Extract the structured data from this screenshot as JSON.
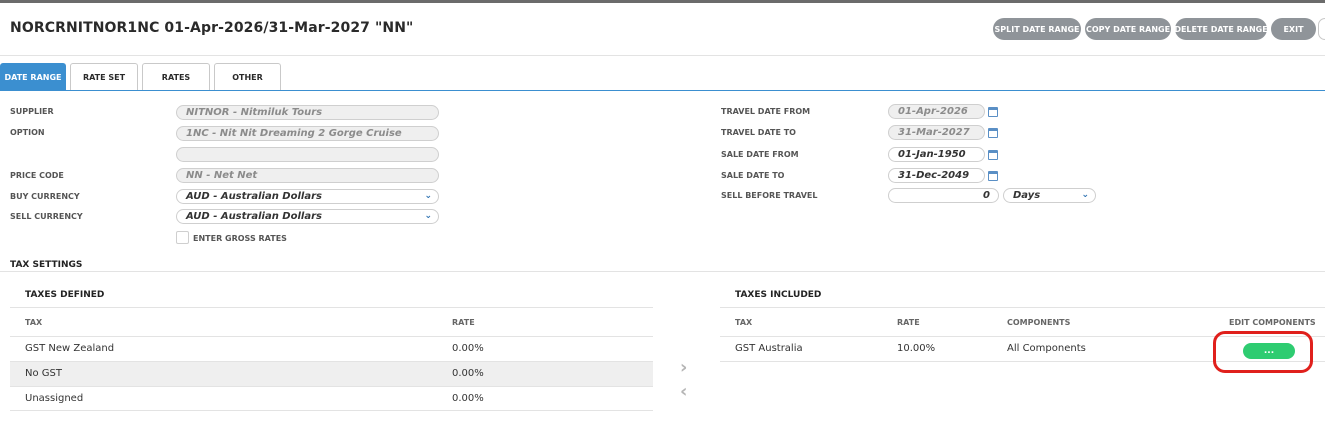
{
  "title": "NORCRNITNOR1NC 01-Apr-2026/31-Mar-2027 \"NN\"",
  "toolbar": {
    "split": "SPLIT DATE RANGE",
    "copy": "COPY DATE RANGE",
    "delete": "DELETE DATE RANGE",
    "exit": "EXIT"
  },
  "tabs": [
    "DATE RANGE",
    "RATE SET",
    "RATES",
    "OTHER"
  ],
  "form": {
    "supplier_label": "SUPPLIER",
    "supplier_value": "NITNOR - Nitmiluk Tours",
    "option_label": "OPTION",
    "option_value": "1NC - Nit Nit Dreaming 2 Gorge Cruise",
    "price_code_label": "PRICE CODE",
    "price_code_value": "NN - Net Net",
    "buy_currency_label": "BUY CURRENCY",
    "buy_currency_value": "AUD - Australian Dollars",
    "sell_currency_label": "SELL CURRENCY",
    "sell_currency_value": "AUD - Australian Dollars",
    "gross_rates_label": "ENTER GROSS RATES",
    "travel_from_label": "TRAVEL DATE FROM",
    "travel_from_value": "01-Apr-2026",
    "travel_to_label": "TRAVEL DATE TO",
    "travel_to_value": "31-Mar-2027",
    "sale_from_label": "SALE DATE FROM",
    "sale_from_value": "01-Jan-1950",
    "sale_to_label": "SALE DATE TO",
    "sale_to_value": "31-Dec-2049",
    "sell_before_label": "SELL BEFORE TRAVEL",
    "sell_before_value": "0",
    "sell_before_unit": "Days"
  },
  "tax": {
    "section_title": "TAX SETTINGS",
    "defined_title": "TAXES DEFINED",
    "defined_headers": {
      "tax": "TAX",
      "rate": "RATE"
    },
    "defined_rows": [
      {
        "tax": "GST New Zealand",
        "rate": "0.00%"
      },
      {
        "tax": "No GST",
        "rate": "0.00%"
      },
      {
        "tax": "Unassigned",
        "rate": "0.00%"
      }
    ],
    "included_title": "TAXES INCLUDED",
    "included_headers": {
      "tax": "TAX",
      "rate": "RATE",
      "components": "COMPONENTS",
      "edit": "EDIT COMPONENTS"
    },
    "included_rows": [
      {
        "tax": "GST Australia",
        "rate": "10.00%",
        "components": "All Components",
        "edit": "..."
      }
    ]
  },
  "colors": {
    "accent": "#3b8fd0",
    "button_gray": "#8f9499",
    "edit_green": "#2ecc71",
    "annotation_red": "#e0201c"
  },
  "icons": [
    "calendar-icon",
    "chevron-down-icon",
    "chevron-right-icon",
    "chevron-left-icon"
  ]
}
